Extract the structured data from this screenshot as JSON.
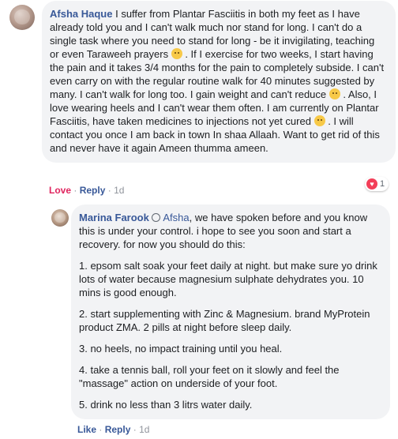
{
  "comment1": {
    "author": "Afsha Haque",
    "text_parts": [
      "I suffer from Plantar Fasciitis in both my feet as I have already told you and I can't walk much nor stand for long. I can't do a single task where you need to stand for long - be it invigilating, teaching or even Taraweeh prayers ",
      ". If I exercise for two weeks, I start having the pain and it takes 3/4 months for the pain to completely subside. I can't even carry on with the regular routine walk for 40 minutes suggested by many. I can't walk for long too. I gain weight and can't reduce ",
      ". Also, I love wearing heels and I can't wear them often. I am currently on Plantar Fasciitis, have taken medicines to injections not yet cured ",
      ". I will contact you once I am back in town In shaa Allaah. Want to get rid of this and never have it again Ameen thumma ameen."
    ],
    "emoji_icons": [
      "sad-face-icon",
      "sad-face-icon",
      "disappointed-face-icon"
    ],
    "actions": {
      "love": "Love",
      "reply": "Reply",
      "time": "1d",
      "sep": "·"
    },
    "reaction": {
      "icon": "heart-icon",
      "count": "1",
      "color": "#f33e58"
    }
  },
  "comment2": {
    "author": "Marina Farook",
    "badge_icon": "top-fan-badge-icon",
    "mention": "Afsha",
    "intro": ", we have spoken before and you know this is under your control. i hope to see you soon and start a recovery. for now you should do this:",
    "points": [
      "1. epsom salt soak your feet daily at night. but make sure yo drink lots of water because magnesium sulphate dehydrates you. 10 mins is good enough.",
      "2. start supplementing with Zinc & Magnesium. brand MyProtein product ZMA. 2 pills at night before sleep daily.",
      "3. no heels, no impact training until you heal.",
      "4. take a tennis ball, roll your feet on it slowly and feel the \"massage\" action on underside of your foot.",
      "5. drink no less than 3 litrs water daily."
    ],
    "actions": {
      "like": "Like",
      "reply": "Reply",
      "time": "1d",
      "sep": "·"
    }
  },
  "colors": {
    "link": "#385898",
    "bubble": "#f2f3f5",
    "love": "#e0245e",
    "meta": "#90949c"
  }
}
